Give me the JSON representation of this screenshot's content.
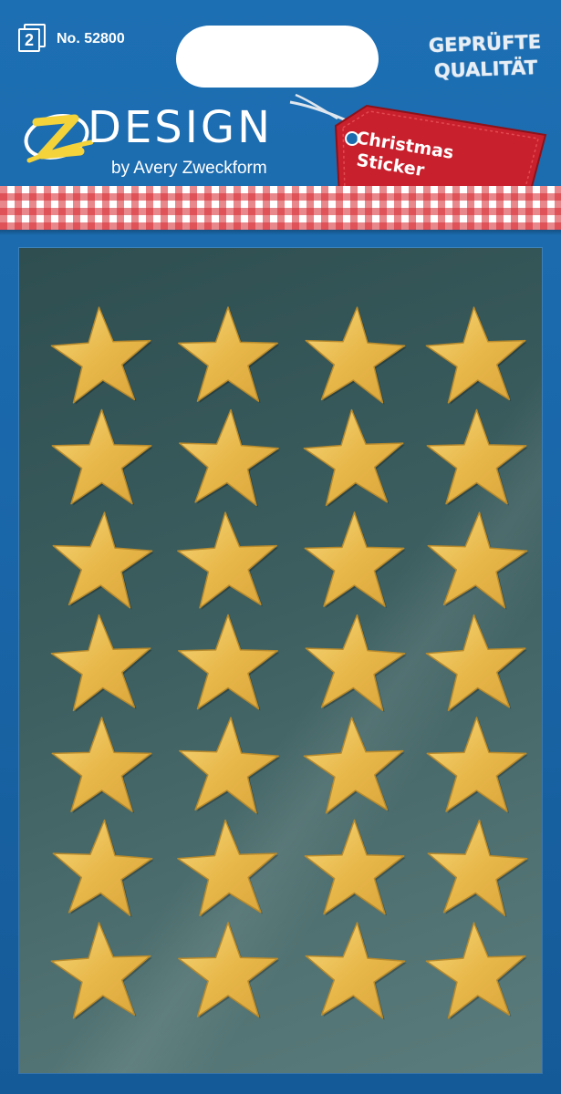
{
  "header": {
    "sheet_count": "2",
    "item_number": "No. 52800",
    "quality_badge": {
      "line1": "GEPRÜFTE",
      "line2": "QUALITÄT"
    },
    "logo_icon": "z-swoosh-icon"
  },
  "brand": {
    "name": "DESIGN",
    "subtitle": "by Avery Zweckform"
  },
  "gift_tag": {
    "line1": "Christmas",
    "line2": "Sticker",
    "color": "#c8202c"
  },
  "colors": {
    "background": "#1b6cae",
    "gingham": "#d6262e",
    "sheet": "#3d5f60",
    "star_gold": "#e8b84a"
  },
  "sticker_sheet": {
    "rows": 7,
    "columns": 4,
    "sticker_icon": "gold-star-icon"
  }
}
